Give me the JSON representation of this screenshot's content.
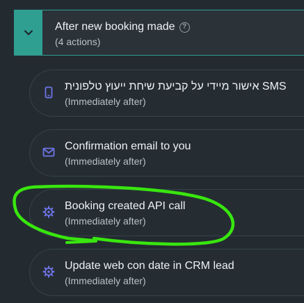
{
  "header": {
    "title": "After new booking made",
    "subtitle": "(4 actions)"
  },
  "actions": [
    {
      "title": "אישור מיידי על קביעת שיחת ייעוץ טלפונית SMS",
      "timing": "(Immediately after)",
      "icon": "phone-icon"
    },
    {
      "title": "Confirmation email to you",
      "timing": "(Immediately after)",
      "icon": "envelope-icon"
    },
    {
      "title": "Booking created API call",
      "timing": "(Immediately after)",
      "icon": "gear-icon"
    },
    {
      "title": "Update web con date in CRM lead",
      "timing": "(Immediately after)",
      "icon": "gear-icon"
    }
  ],
  "colors": {
    "accent": "#2f9f92",
    "icon": "#6f74e8",
    "highlight": "#39e60f"
  }
}
